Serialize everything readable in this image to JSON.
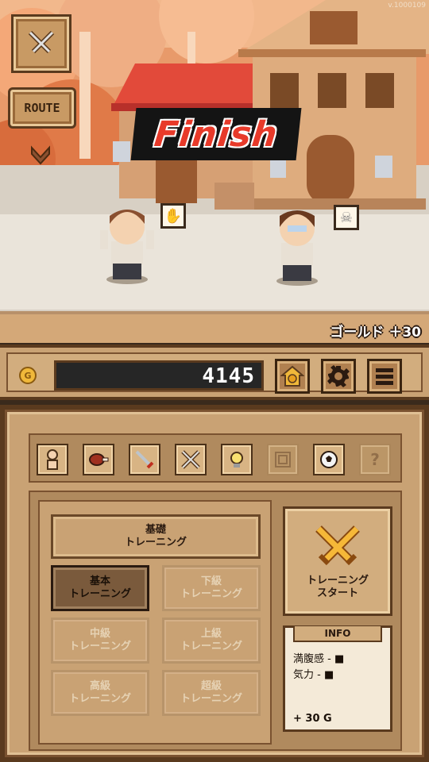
{
  "version": "v.1000109",
  "scene": {
    "route_label": "ROUTE",
    "finish_text": "Finish",
    "gold_reward": "ゴールド ＋30"
  },
  "status": {
    "coin_symbol": "G",
    "gold_amount": "4145"
  },
  "categories": [
    {
      "icon": "person-icon",
      "enabled": true
    },
    {
      "icon": "meat-icon",
      "enabled": true
    },
    {
      "icon": "sword-icon",
      "enabled": true
    },
    {
      "icon": "crossed-swords-icon",
      "enabled": true
    },
    {
      "icon": "bulb-icon",
      "enabled": true
    },
    {
      "icon": "scroll-icon",
      "enabled": false
    },
    {
      "icon": "ball-icon",
      "enabled": true
    },
    {
      "icon": "question-icon",
      "enabled": false
    }
  ],
  "training": {
    "header_line1": "基礎",
    "header_line2": "トレーニング",
    "basic_line1": "基本",
    "basic_line2": "トレーニング",
    "low_line1": "下級",
    "low_line2": "トレーニング",
    "mid_line1": "中級",
    "mid_line2": "トレーニング",
    "upper_line1": "上級",
    "upper_line2": "トレーニング",
    "high_line1": "高級",
    "high_line2": "トレーニング",
    "super_line1": "超級",
    "super_line2": "トレーニング",
    "start_line1": "トレーニング",
    "start_line2": "スタート"
  },
  "info": {
    "title": "INFO",
    "satiety": "満腹感 - ■",
    "energy": "気力 - ■",
    "gold": "+ 30 G"
  },
  "colors": {
    "finish_red": "#e83a2a",
    "panel_tan": "#c9a274",
    "frame_brown": "#5a3a1e"
  }
}
